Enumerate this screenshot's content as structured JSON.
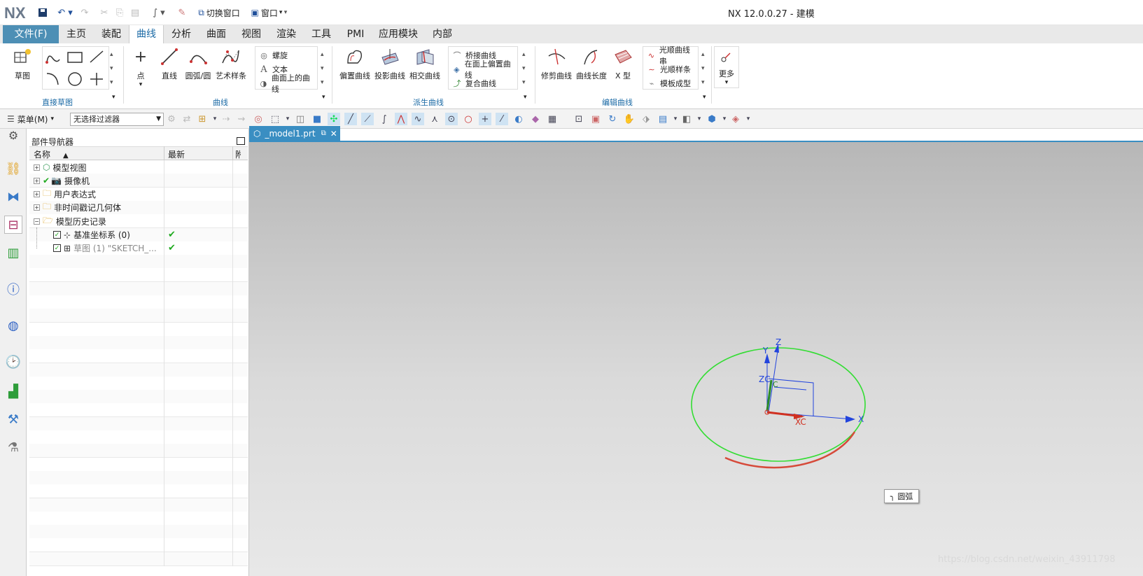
{
  "titlebar": {
    "logo": "NX",
    "switch_window": "切换窗口",
    "window": "窗口",
    "app_title": "NX 12.0.0.27 - 建模"
  },
  "tabs": {
    "file": "文件(F)",
    "items": [
      "主页",
      "装配",
      "曲线",
      "分析",
      "曲面",
      "视图",
      "渲染",
      "工具",
      "PMI",
      "应用模块",
      "内部"
    ],
    "active": "曲线"
  },
  "ribbon": {
    "sketch": "草图",
    "group_direct_sketch": "直接草图",
    "point": "点",
    "line": "直线",
    "arc_circle": "圆弧/圆",
    "studio_spline": "艺术样条",
    "helix": "螺旋",
    "text": "文本",
    "curve_on_surface": "曲面上的曲线",
    "group_curve": "曲线",
    "offset_curve": "偏置曲线",
    "projected_curve": "投影曲线",
    "intersection_curve": "相交曲线",
    "bridge_curve": "桥接曲线",
    "offset_in_face": "在面上偏置曲线",
    "composite_curve": "复合曲线",
    "group_derived": "派生曲线",
    "trim_curve": "修剪曲线",
    "curve_length": "曲线长度",
    "x_form": "X 型",
    "smooth_string": "光顺曲线串",
    "smooth_spline": "光顺样条",
    "template_shape": "模板成型",
    "group_edit": "编辑曲线",
    "more": "更多"
  },
  "toolbar2": {
    "menu": "菜单(M)",
    "filter": "无选择过滤器"
  },
  "navigator": {
    "title": "部件导航器",
    "col_name": "名称",
    "col_latest": "最新",
    "col_extra": "附",
    "rows": [
      {
        "label": "模型视图",
        "expander": "+",
        "latest": ""
      },
      {
        "label": "摄像机",
        "expander": "+",
        "latest": ""
      },
      {
        "label": "用户表达式",
        "expander": "+",
        "latest": ""
      },
      {
        "label": "非时间戳记几何体",
        "expander": "+",
        "latest": ""
      },
      {
        "label": "模型历史记录",
        "expander": "−",
        "latest": ""
      },
      {
        "label": "基准坐标系 (0)",
        "expander": "",
        "latest": "✔"
      },
      {
        "label": "草图 (1) \"SKETCH_...",
        "expander": "",
        "latest": "✔"
      }
    ]
  },
  "viewport": {
    "tab_label": "_model1.prt",
    "axis_x": "X",
    "axis_y": "Y",
    "axis_z": "Z",
    "axis_xc": "XC",
    "axis_zc": "ZC",
    "axis_c": "C",
    "tooltip": "圆弧",
    "watermark": "https://blog.csdn.net/weixin_43911798"
  },
  "colors": {
    "file_tab": "#4d8fb5",
    "accent": "#1b6aa5",
    "circle_green": "#33dd33",
    "arc_red": "#d64a3a"
  }
}
